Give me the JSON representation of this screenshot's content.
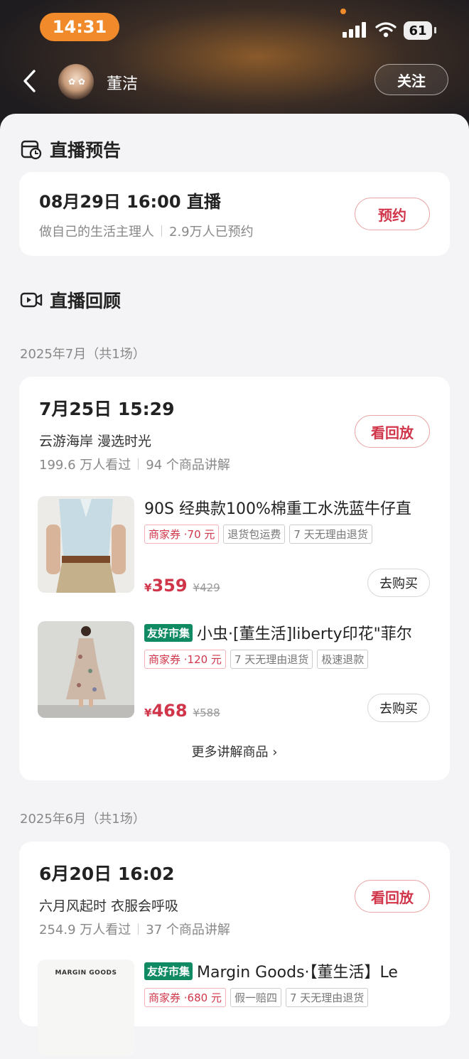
{
  "status_bar": {
    "time": "14:31",
    "battery": "61"
  },
  "header": {
    "user_name": "董洁",
    "follow_label": "关注"
  },
  "preview": {
    "section_title": "直播预告",
    "datetime": "08月29日 16:00 直播",
    "subtitle": "做自己的生活主理人",
    "reservations": "2.9万人已预约",
    "reserve_label": "预约"
  },
  "review": {
    "section_title": "直播回顾",
    "groups": [
      {
        "month": "2025年7月（共1场）",
        "date": "7月25日 15:29",
        "title": "云游海岸 漫选时光",
        "views": "199.6 万人看过",
        "products_count": "94 个商品讲解",
        "replay_label": "看回放",
        "products": [
          {
            "tag": "",
            "title": "90S 经典款100%棉重工水洗蓝牛仔直",
            "tags": [
              "商家券 ·70 元",
              "退货包运费",
              "7 天无理由退货"
            ],
            "currency": "¥",
            "price": "359",
            "original_price": "¥429",
            "buy_label": "去购买"
          },
          {
            "tag": "友好市集",
            "title": "小虫·[董生活]liberty印花\"菲尔",
            "tags": [
              "商家券 ·120 元",
              "7 天无理由退货",
              "极速退款"
            ],
            "currency": "¥",
            "price": "468",
            "original_price": "¥588",
            "buy_label": "去购买"
          }
        ],
        "more_label": "更多讲解商品 ›"
      },
      {
        "month": "2025年6月（共1场）",
        "date": "6月20日 16:02",
        "title": "六月风起时  衣服会呼吸",
        "views": "254.9 万人看过",
        "products_count": "37 个商品讲解",
        "replay_label": "看回放",
        "products": [
          {
            "tag": "友好市集",
            "title": "Margin Goods·【董生活】Le",
            "tags": [
              "商家券 ·680 元",
              "假一赔四",
              "7 天无理由退货"
            ],
            "thumb_text": "MARGIN GOODS"
          }
        ]
      }
    ]
  },
  "colors": {
    "accent_red": "#d0354a",
    "friendly_green": "#0f8a63",
    "status_orange": "#f08a2a"
  },
  "icons": [
    "back-arrow-icon",
    "signal-icon",
    "wifi-icon",
    "battery-icon",
    "calendar-clock-icon",
    "video-icon",
    "chevron-right-icon"
  ]
}
